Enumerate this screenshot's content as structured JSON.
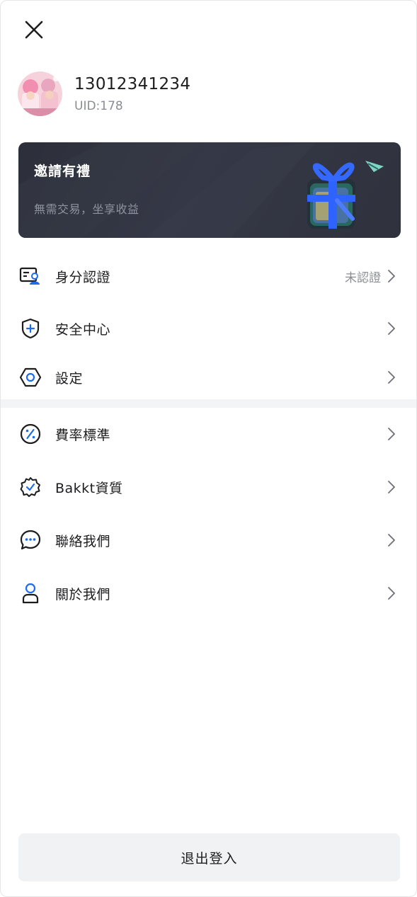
{
  "header": {
    "close_icon": "close-icon"
  },
  "profile": {
    "phone": "13012341234",
    "uid": "UID:178"
  },
  "banner": {
    "title": "邀請有禮",
    "subtitle": "無需交易，坐享收益"
  },
  "menu": {
    "section1": [
      {
        "label": "身分認證",
        "icon": "id-card-icon",
        "status": "未認證"
      },
      {
        "label": "安全中心",
        "icon": "shield-icon",
        "status": ""
      },
      {
        "label": "設定",
        "icon": "settings-icon",
        "status": ""
      }
    ],
    "section2": [
      {
        "label": "費率標準",
        "icon": "percent-icon",
        "status": ""
      },
      {
        "label": "Bakkt資質",
        "icon": "badge-icon",
        "status": ""
      },
      {
        "label": "聯絡我們",
        "icon": "chat-icon",
        "status": ""
      },
      {
        "label": "關於我們",
        "icon": "user-icon",
        "status": ""
      }
    ]
  },
  "footer": {
    "logout_label": "退出登入"
  },
  "colors": {
    "accent": "#1e6bf0",
    "banner_bg": "#2f323d",
    "divider": "#f3f4f6",
    "button_bg": "#f1f2f4"
  }
}
